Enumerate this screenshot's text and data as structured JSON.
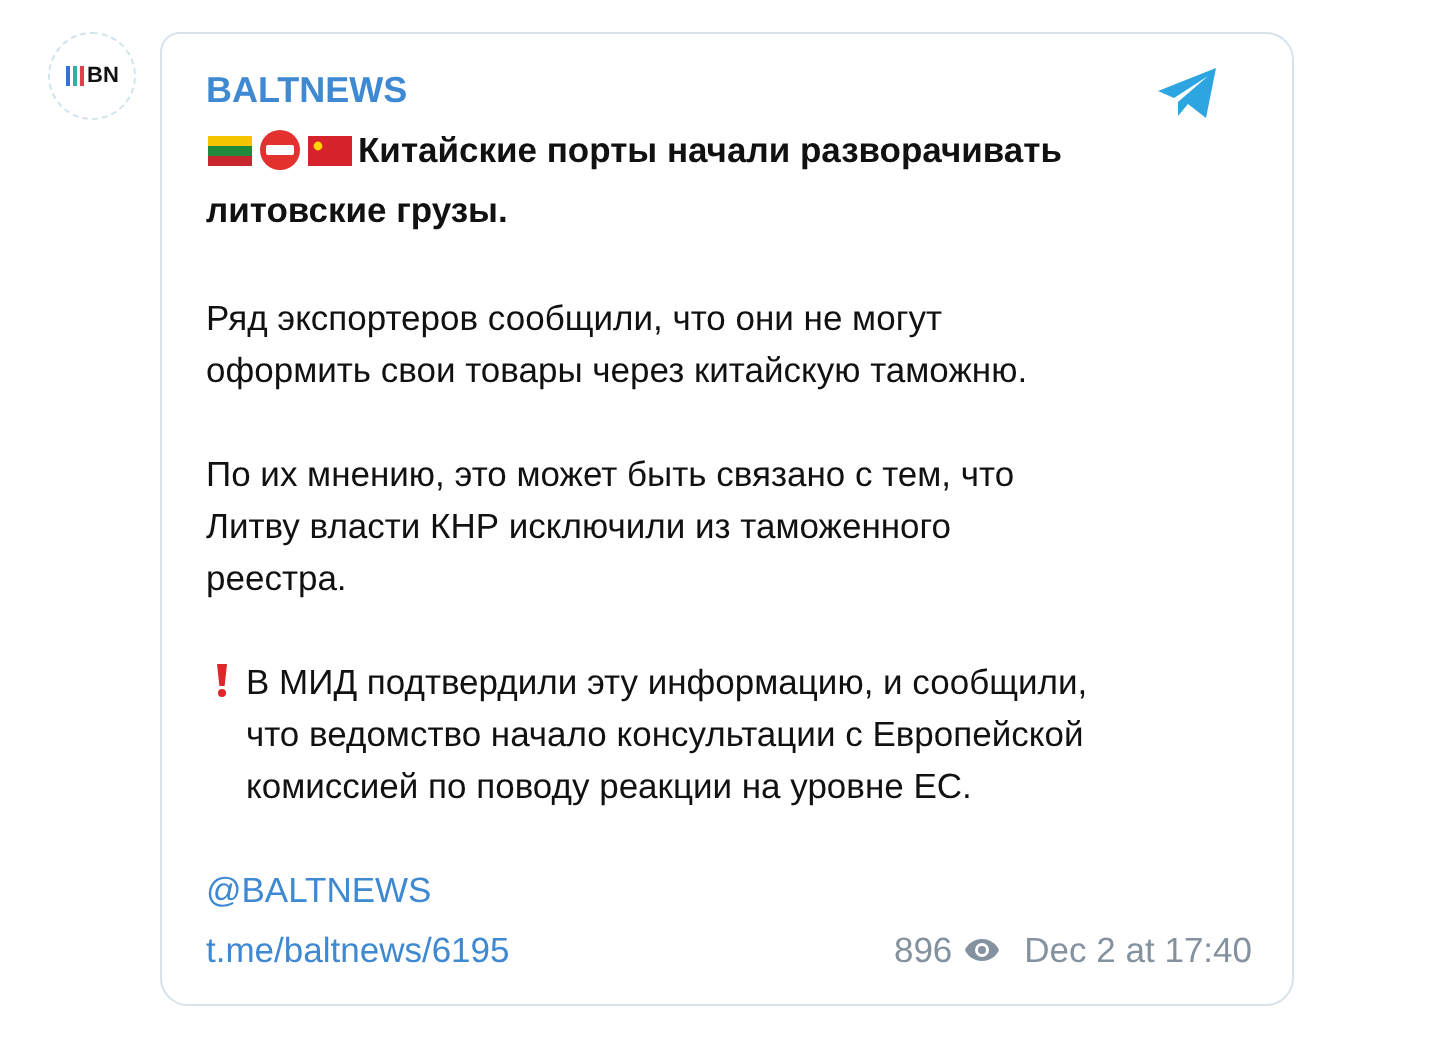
{
  "channel": {
    "logo_text": "BN",
    "name": "BALTNEWS"
  },
  "post": {
    "headline_lines": [
      "Китайские порты начали разворачивать",
      "литовские грузы."
    ],
    "paragraphs": [
      {
        "kind": "plain",
        "lines": [
          "Ряд экспортеров сообщили, что они не могут",
          "оформить свои товары через китайскую таможню."
        ]
      },
      {
        "kind": "plain",
        "lines": [
          "По их мнению, это может быть связано с тем, что",
          "Литву власти КНР исключили из таможенного",
          "реестра."
        ]
      },
      {
        "kind": "alert",
        "lines": [
          "В МИД подтвердили эту информацию, и сообщили,",
          "что ведомство начало консультации с Европейской",
          "комиссией по поводу реакции на уровне ЕС."
        ]
      }
    ],
    "mention": "@BALTNEWS",
    "link": "t.me/baltnews/6195",
    "views": "896",
    "date": "Dec 2 at 17:40"
  }
}
